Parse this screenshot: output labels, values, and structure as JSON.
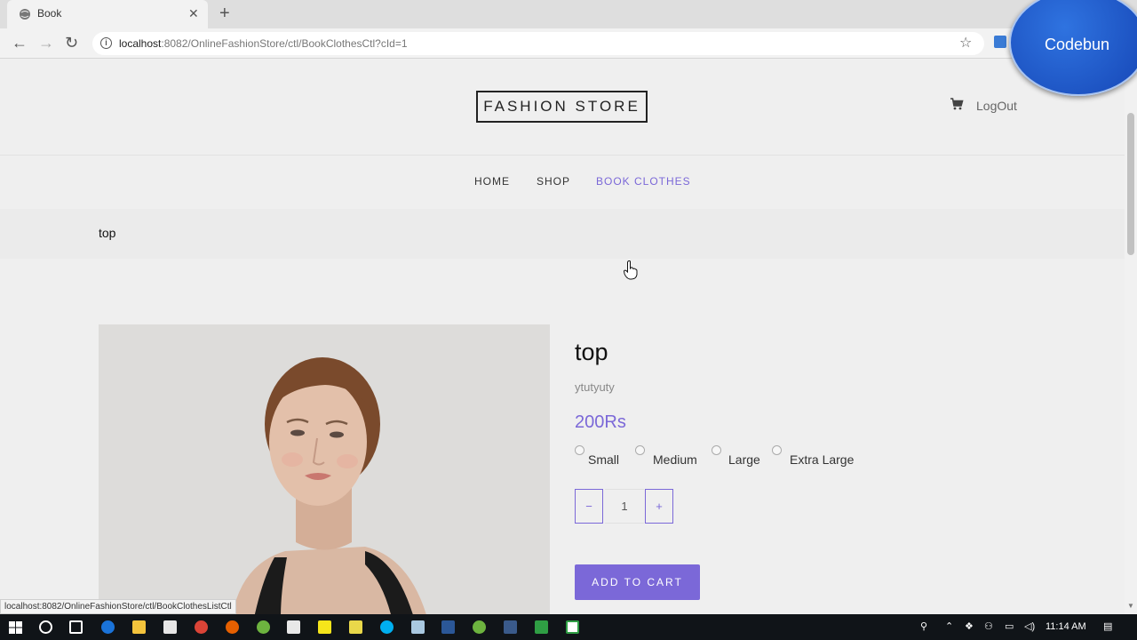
{
  "browser": {
    "tab_title": "Book",
    "url_host": "localhost",
    "url_rest": ":8082/OnlineFashionStore/ctl/BookClothesCtl?cId=1",
    "status_url": "localhost:8082/OnlineFashionStore/ctl/BookClothesListCtl"
  },
  "overlay": {
    "label": "Codebun"
  },
  "header": {
    "logo": "FASHION STORE",
    "logout": "LogOut",
    "cart_icon": "cart-icon"
  },
  "nav": {
    "items": [
      {
        "label": "HOME"
      },
      {
        "label": "SHOP"
      },
      {
        "label": "BOOK CLOTHES",
        "active": true
      }
    ]
  },
  "breadcrumb": "top",
  "product": {
    "title": "top",
    "description": "ytutyuty",
    "price": "200Rs",
    "sizes": [
      "Small",
      "Medium",
      "Large",
      "Extra Large"
    ],
    "quantity": "1",
    "minus_label": "−",
    "plus_label": "+",
    "add_to_cart": "ADD TO CART"
  },
  "taskbar": {
    "time": "11:14 AM"
  },
  "colors": {
    "accent": "#7b68d8",
    "page_bg": "#efefef",
    "taskbar": "#101418",
    "overlay_blue": "#1f5ccc"
  }
}
